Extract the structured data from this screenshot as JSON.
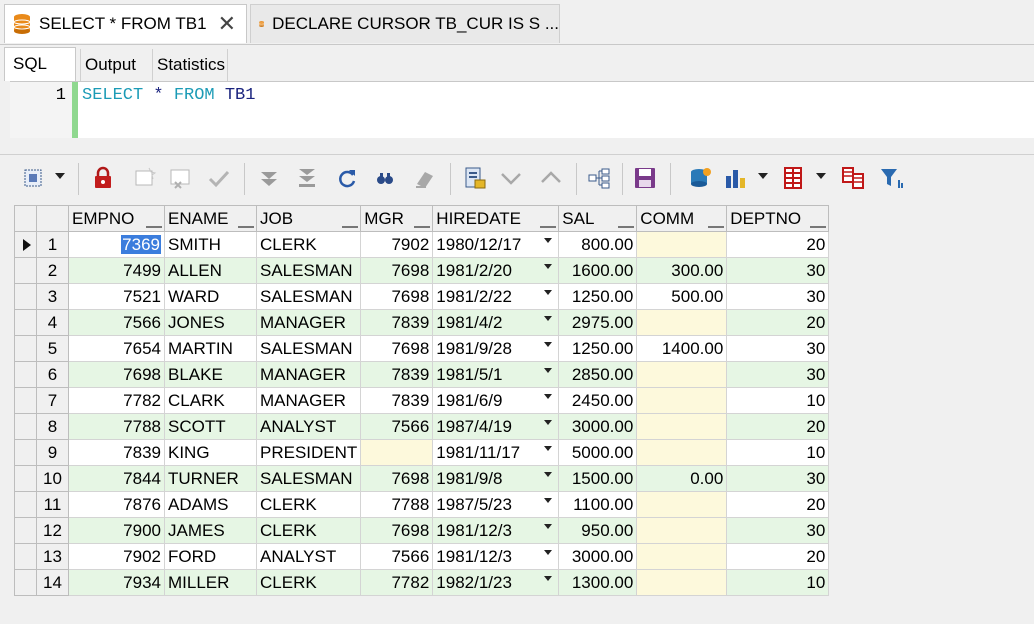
{
  "doc_tabs": [
    {
      "label": "SELECT * FROM TB1",
      "active": true
    },
    {
      "label": "DECLARE CURSOR TB_CUR IS S ...",
      "active": false
    }
  ],
  "sub_tabs": [
    "SQL",
    "Output",
    "Statistics"
  ],
  "editor": {
    "line_number": "1",
    "tokens": [
      {
        "text": "SELECT",
        "kind": "kw"
      },
      {
        "text": " * ",
        "kind": "id"
      },
      {
        "text": "FROM",
        "kind": "kw"
      },
      {
        "text": " TB1",
        "kind": "id"
      }
    ]
  },
  "toolbar_icons": [
    "grid-select-icon",
    "lock-icon",
    "insert-record-icon",
    "delete-record-icon",
    "post-record-icon",
    "fetch-next-icon",
    "fetch-last-icon",
    "refresh-icon",
    "find-icon",
    "clear-icon",
    "export-icon",
    "sort-desc-icon",
    "sort-asc-icon",
    "query-tree-icon",
    "save-icon",
    "data-source-icon",
    "chart-icon",
    "grid-view-icon",
    "compare-icon",
    "filter-icon"
  ],
  "grid": {
    "columns": [
      "EMPNO",
      "ENAME",
      "JOB",
      "MGR",
      "HIREDATE",
      "SAL",
      "COMM",
      "DEPTNO"
    ],
    "rows": [
      [
        "7369",
        "SMITH",
        "CLERK",
        "7902",
        "1980/12/17",
        "800.00",
        "",
        "20"
      ],
      [
        "7499",
        "ALLEN",
        "SALESMAN",
        "7698",
        "1981/2/20",
        "1600.00",
        "300.00",
        "30"
      ],
      [
        "7521",
        "WARD",
        "SALESMAN",
        "7698",
        "1981/2/22",
        "1250.00",
        "500.00",
        "30"
      ],
      [
        "7566",
        "JONES",
        "MANAGER",
        "7839",
        "1981/4/2",
        "2975.00",
        "",
        "20"
      ],
      [
        "7654",
        "MARTIN",
        "SALESMAN",
        "7698",
        "1981/9/28",
        "1250.00",
        "1400.00",
        "30"
      ],
      [
        "7698",
        "BLAKE",
        "MANAGER",
        "7839",
        "1981/5/1",
        "2850.00",
        "",
        "30"
      ],
      [
        "7782",
        "CLARK",
        "MANAGER",
        "7839",
        "1981/6/9",
        "2450.00",
        "",
        "10"
      ],
      [
        "7788",
        "SCOTT",
        "ANALYST",
        "7566",
        "1987/4/19",
        "3000.00",
        "",
        "20"
      ],
      [
        "7839",
        "KING",
        "PRESIDENT",
        "",
        "1981/11/17",
        "5000.00",
        "",
        "10"
      ],
      [
        "7844",
        "TURNER",
        "SALESMAN",
        "7698",
        "1981/9/8",
        "1500.00",
        "0.00",
        "30"
      ],
      [
        "7876",
        "ADAMS",
        "CLERK",
        "7788",
        "1987/5/23",
        "1100.00",
        "",
        "20"
      ],
      [
        "7900",
        "JAMES",
        "CLERK",
        "7698",
        "1981/12/3",
        "950.00",
        "",
        "30"
      ],
      [
        "7902",
        "FORD",
        "ANALYST",
        "7566",
        "1981/12/3",
        "3000.00",
        "",
        "20"
      ],
      [
        "7934",
        "MILLER",
        "CLERK",
        "7782",
        "1982/1/23",
        "1300.00",
        "",
        "10"
      ]
    ]
  },
  "colors": {
    "keyword": "#1b9bb6",
    "even_row": "#e6f6e4",
    "null_cell": "#fdf9dc",
    "selection": "#3b7ddd"
  }
}
